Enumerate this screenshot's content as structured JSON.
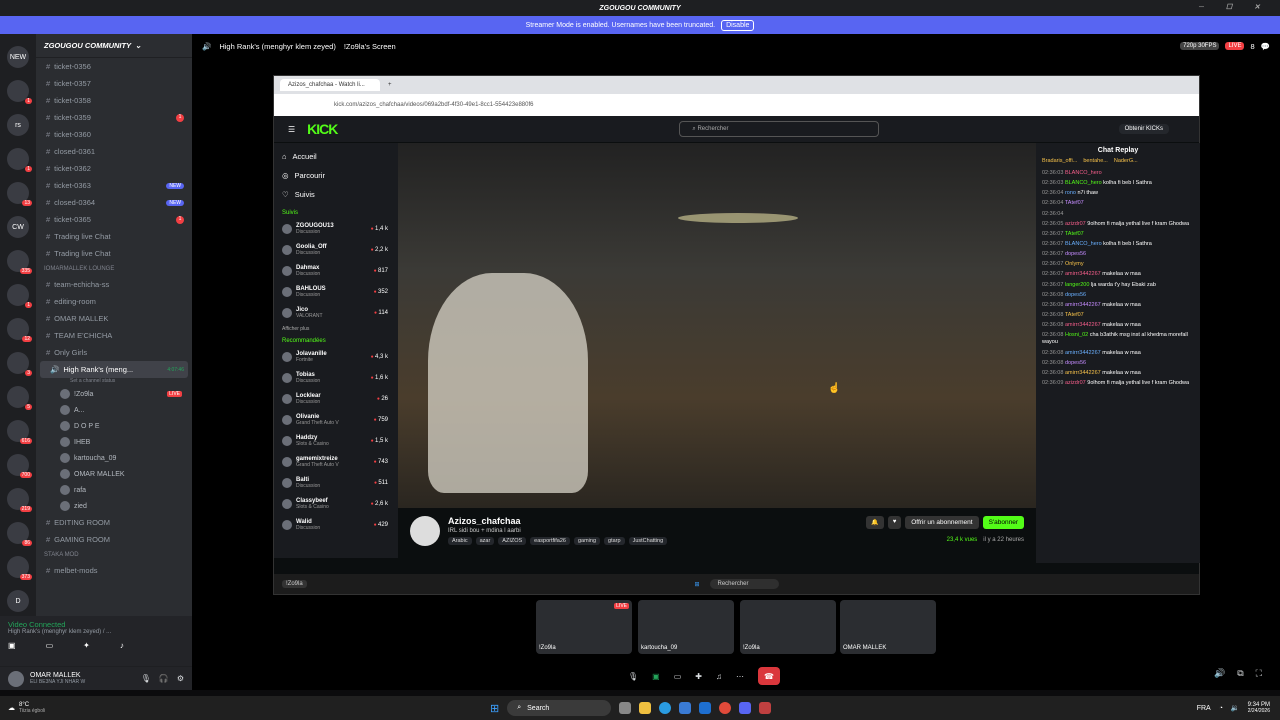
{
  "window": {
    "title": "ZGOUGOU COMMUNITY"
  },
  "banner": {
    "text": "Streamer Mode is enabled. Usernames have been truncated.",
    "disable": "Disable"
  },
  "servers": [
    {
      "label": "NEW",
      "badge": ""
    },
    {
      "label": "",
      "badge": "1"
    },
    {
      "label": "rs",
      "badge": ""
    },
    {
      "label": "",
      "badge": "1"
    },
    {
      "label": "",
      "badge": "13"
    },
    {
      "label": "CW",
      "badge": ""
    },
    {
      "label": "",
      "badge": "335"
    },
    {
      "label": "",
      "badge": "1"
    },
    {
      "label": "",
      "badge": "12"
    },
    {
      "label": "",
      "badge": "3"
    },
    {
      "label": "",
      "badge": "5"
    },
    {
      "label": "",
      "badge": "616"
    },
    {
      "label": "",
      "badge": "700"
    },
    {
      "label": "",
      "badge": "219"
    },
    {
      "label": "",
      "badge": "86"
    },
    {
      "label": "",
      "badge": "373"
    },
    {
      "label": "D",
      "badge": ""
    },
    {
      "label": "",
      "badge": "116"
    }
  ],
  "guild": {
    "name": "ZGOUGOU COMMUNITY"
  },
  "channels": [
    {
      "name": "ticket-0356",
      "tag": ""
    },
    {
      "name": "ticket-0357",
      "tag": ""
    },
    {
      "name": "ticket-0358",
      "tag": ""
    },
    {
      "name": "ticket-0359",
      "tag": "1"
    },
    {
      "name": "ticket-0360",
      "tag": ""
    },
    {
      "name": "closed-0361",
      "tag": ""
    },
    {
      "name": "ticket-0362",
      "tag": ""
    },
    {
      "name": "ticket-0363",
      "tag": "NEW"
    },
    {
      "name": "closed-0364",
      "tag": "NEW"
    },
    {
      "name": "ticket-0365",
      "tag": "1"
    },
    {
      "name": "Trading live Chat",
      "tag": ""
    },
    {
      "name": "Trading live Chat",
      "tag": ""
    }
  ],
  "category1": "IOMARMALLEK LOUNGE",
  "channels2": [
    "team-echicha-ss",
    "editing-room",
    "OMAR MALLEK",
    "TEAM E'CHICHA",
    "Only Girls"
  ],
  "active_channel": "High Rank's (meng...",
  "active_time": "4:07:46",
  "active_status": "Set a channel status",
  "voice_users": [
    "!Zo9la",
    "A...",
    "D O P E",
    "IHEB",
    "kartoucha_09",
    "OMAR MALLEK",
    "rafa",
    "zied"
  ],
  "voice_live": "LIVE",
  "channels3": [
    "EDITING ROOM",
    "GAMING ROOM"
  ],
  "category2": "Staka Mod",
  "channel4": "melbet-mods",
  "vc": {
    "title": "Video Connected",
    "sub": "High Rank's (menghyr klem zeyed) / ..."
  },
  "user": {
    "name": "OMAR MALLEK",
    "status": "ELI BE3NA YJI NHAR W"
  },
  "topbar": {
    "channel": "High Rank's (menghyr klem zeyed)",
    "screen": "!Zo9la's Screen",
    "quality": "720p 30FPS",
    "live": "LIVE",
    "count": "8"
  },
  "browser": {
    "tab": "Azizos_chafchaa - Watch li...",
    "url": "kick.com/azizos_chafchaa/videos/069a2bdf-4f30-49e1-8cc1-554423e880f6"
  },
  "kick": {
    "logo": "KICK",
    "search": "Rechercher",
    "get": "Obtenir KICKs",
    "nav": [
      "Accueil",
      "Parcourir",
      "Suivis"
    ],
    "suivis_head": "Suivis",
    "suivis": [
      {
        "name": "ZGOUGOU13",
        "sub": "Discussion",
        "views": "1,4 k"
      },
      {
        "name": "Goolia_Off",
        "sub": "Discussion",
        "views": "2,2 k"
      },
      {
        "name": "Dahmax",
        "sub": "Discussion",
        "views": "817"
      },
      {
        "name": "BAHLOUS",
        "sub": "Discussion",
        "views": "352"
      },
      {
        "name": "Jico",
        "sub": "VALORANT",
        "views": "114"
      }
    ],
    "more": "Afficher plus",
    "reco_head": "Recommandées",
    "reco": [
      {
        "name": "Jolavanille",
        "sub": "Fortnite",
        "views": "4,3 k"
      },
      {
        "name": "Tobias",
        "sub": "Discussion",
        "views": "1,6 k"
      },
      {
        "name": "Locklear",
        "sub": "Discussion",
        "views": "26"
      },
      {
        "name": "Olivanie",
        "sub": "Grand Theft Auto V",
        "views": "759"
      },
      {
        "name": "Haddzy",
        "sub": "Slots & Casino",
        "views": "1,5 k"
      },
      {
        "name": "gamemixtreize",
        "sub": "Grand Theft Auto V",
        "views": "743"
      },
      {
        "name": "Balti",
        "sub": "Discussion",
        "views": "511"
      },
      {
        "name": "Classybeef",
        "sub": "Slots & Casino",
        "views": "2,6 k"
      },
      {
        "name": "Walid",
        "sub": "Discussion",
        "views": "429"
      }
    ],
    "streamer": "Azizos_chafchaa",
    "stream_title": "IRL sidi bou + mdina l aarbi",
    "tags": [
      "Arabic",
      "azar",
      "AZIZOS",
      "easportfifa26",
      "gaming",
      "gtarp",
      "JustChatting"
    ],
    "views": "23,4 k vues",
    "ago": "il y a 22 heures",
    "gift": "Offrir un abonnement",
    "sub": "S'abonner",
    "chat_title": "Chat Replay"
  },
  "chat": [
    {
      "ts": "02:36:03",
      "user": "BLANCO_hero",
      "msg": ""
    },
    {
      "ts": "02:36:03",
      "user": "BLANCO_hero",
      "msg": "kolha fi beb l Sathra"
    },
    {
      "ts": "02:36:04",
      "user": "rono",
      "msg": "n7i thaw"
    },
    {
      "ts": "02:36:04",
      "user": "TAtef07",
      "msg": ""
    },
    {
      "ts": "02:36:04",
      "user": "",
      "msg": ""
    },
    {
      "ts": "02:36:05",
      "user": "azizdr07",
      "msg": "9olhom fi malja yethal live f kram Ghodwa"
    },
    {
      "ts": "02:36:07",
      "user": "TAtef07",
      "msg": ""
    },
    {
      "ts": "02:36:07",
      "user": "BLANCO_hero",
      "msg": "kolha fi beb l Sathra"
    },
    {
      "ts": "02:36:07",
      "user": "dopes56",
      "msg": ""
    },
    {
      "ts": "02:36:07",
      "user": "Onlymy",
      "msg": ""
    },
    {
      "ts": "02:36:07",
      "user": "amirrr3442267",
      "msg": "makelaa w maa"
    },
    {
      "ts": "02:36:07",
      "user": "langer200",
      "msg": "lja warda t'y hay Ebaki zab"
    },
    {
      "ts": "02:36:08",
      "user": "dopes56",
      "msg": ""
    },
    {
      "ts": "02:36:08",
      "user": "amirrr3442267",
      "msg": "makelaa w maa"
    },
    {
      "ts": "02:36:08",
      "user": "TAtef07",
      "msg": ""
    },
    {
      "ts": "02:36:08",
      "user": "amirrr3442267",
      "msg": "makelaa w maa"
    },
    {
      "ts": "02:36:08",
      "user": "Hosni_02",
      "msg": "cha b3athik msg inst al khedma morefall wayou"
    },
    {
      "ts": "02:36:08",
      "user": "amirrr3442267",
      "msg": "makelaa w maa"
    },
    {
      "ts": "02:36:08",
      "user": "dopes56",
      "msg": ""
    },
    {
      "ts": "02:36:08",
      "user": "amirrr3442267",
      "msg": "makelaa w maa"
    },
    {
      "ts": "02:36:09",
      "user": "azizdr07",
      "msg": "9olhom fi malja yethal live f kram Ghodwa"
    }
  ],
  "chat_top": [
    "Bradaris_offi...",
    "bentahe...",
    "NaderG..."
  ],
  "inner_taskbar": {
    "search": "Rechercher",
    "screen_tag": "!Zo9la"
  },
  "thumbs": [
    {
      "name": "!Zo9la",
      "live": "LIVE"
    },
    {
      "name": "kartoucha_09",
      "live": ""
    },
    {
      "name": "!Zo9la",
      "live": ""
    },
    {
      "name": "OMAR MALLEK",
      "live": ""
    }
  ],
  "weather": {
    "temp": "8°C",
    "desc": "Tiizia égboli"
  },
  "win_search": "Search",
  "clock": {
    "time": "9:34 PM",
    "date": "2/24/2026"
  },
  "lang": "FRA"
}
